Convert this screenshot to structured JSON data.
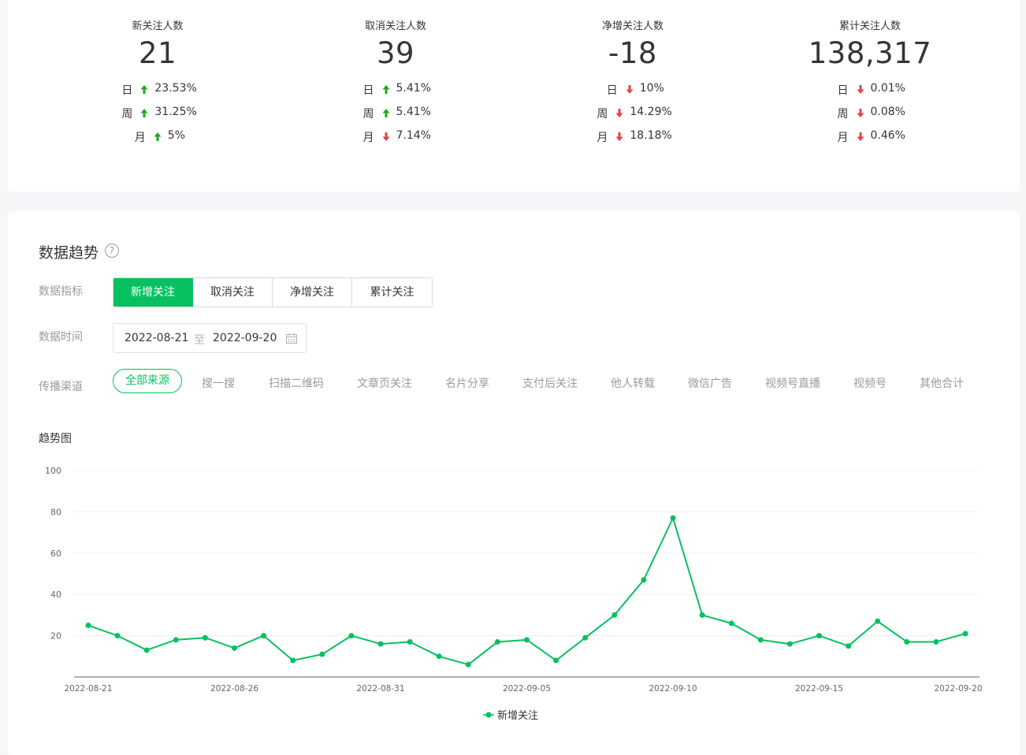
{
  "stats": [
    {
      "title": "新关注人数",
      "value": "21",
      "rows": [
        {
          "label": "日",
          "dir": "up",
          "pct": "23.53%"
        },
        {
          "label": "周",
          "dir": "up",
          "pct": "31.25%"
        },
        {
          "label": "月",
          "dir": "up",
          "pct": "5%"
        }
      ]
    },
    {
      "title": "取消关注人数",
      "value": "39",
      "rows": [
        {
          "label": "日",
          "dir": "up",
          "pct": "5.41%"
        },
        {
          "label": "周",
          "dir": "up",
          "pct": "5.41%"
        },
        {
          "label": "月",
          "dir": "down",
          "pct": "7.14%"
        }
      ]
    },
    {
      "title": "净增关注人数",
      "value": "-18",
      "rows": [
        {
          "label": "日",
          "dir": "down",
          "pct": "10%"
        },
        {
          "label": "周",
          "dir": "down",
          "pct": "14.29%"
        },
        {
          "label": "月",
          "dir": "down",
          "pct": "18.18%"
        }
      ]
    },
    {
      "title": "累计关注人数",
      "value": "138,317",
      "rows": [
        {
          "label": "日",
          "dir": "down",
          "pct": "0.01%"
        },
        {
          "label": "周",
          "dir": "down",
          "pct": "0.08%"
        },
        {
          "label": "月",
          "dir": "down",
          "pct": "0.46%"
        }
      ]
    }
  ],
  "colors": {
    "accent": "#07c160",
    "up": "#1aad19",
    "down": "#e64340"
  },
  "trend": {
    "title": "数据趋势",
    "help_icon": "question-circle-icon",
    "metric_label": "数据指标",
    "metrics": [
      "新增关注",
      "取消关注",
      "净增关注",
      "累计关注"
    ],
    "metric_selected": "新增关注",
    "time_label": "数据时间",
    "date_start": "2022-08-21",
    "date_sep": "至",
    "date_end": "2022-09-20",
    "channel_label": "传播渠道",
    "channels": [
      "全部来源",
      "搜一搜",
      "扫描二维码",
      "文章页关注",
      "名片分享",
      "支付后关注",
      "他人转载",
      "微信广告",
      "视频号直播",
      "视频号",
      "其他合计"
    ],
    "channel_selected": "全部来源",
    "chart_heading": "趋势图"
  },
  "chart_data": {
    "type": "line",
    "ylim": [
      0,
      100
    ],
    "yticks": [
      20,
      40,
      60,
      80,
      100
    ],
    "x": [
      "2022-08-21",
      "2022-08-22",
      "2022-08-23",
      "2022-08-24",
      "2022-08-25",
      "2022-08-26",
      "2022-08-27",
      "2022-08-28",
      "2022-08-29",
      "2022-08-30",
      "2022-08-31",
      "2022-09-01",
      "2022-09-02",
      "2022-09-03",
      "2022-09-04",
      "2022-09-05",
      "2022-09-06",
      "2022-09-07",
      "2022-09-08",
      "2022-09-09",
      "2022-09-10",
      "2022-09-11",
      "2022-09-12",
      "2022-09-13",
      "2022-09-14",
      "2022-09-15",
      "2022-09-16",
      "2022-09-17",
      "2022-09-18",
      "2022-09-19",
      "2022-09-20"
    ],
    "xtick_labels": [
      "2022-08-21",
      "2022-08-26",
      "2022-08-31",
      "2022-09-05",
      "2022-09-10",
      "2022-09-15",
      "2022-09-20"
    ],
    "series": [
      {
        "name": "新增关注",
        "values": [
          25,
          20,
          13,
          18,
          19,
          14,
          20,
          8,
          11,
          20,
          16,
          17,
          10,
          6,
          17,
          18,
          8,
          19,
          30,
          47,
          77,
          30,
          26,
          18,
          16,
          20,
          15,
          27,
          17,
          17,
          21
        ]
      }
    ],
    "grid": true,
    "legend": "bottom"
  }
}
